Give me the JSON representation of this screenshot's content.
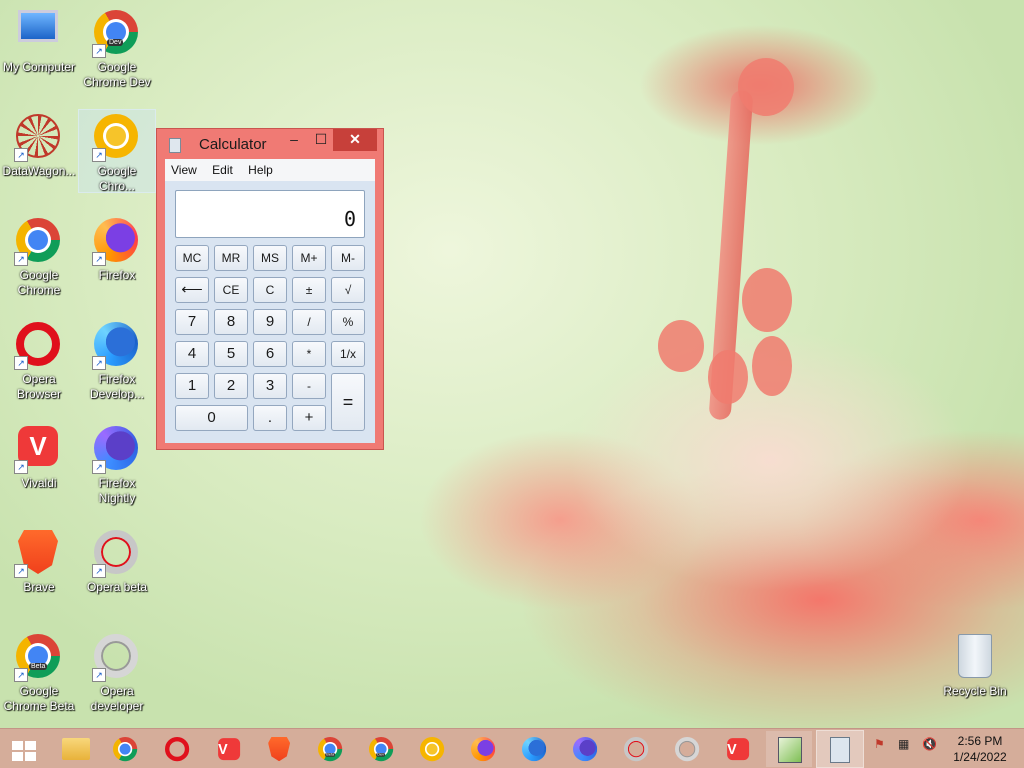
{
  "desktop": {
    "icons": [
      {
        "label": "My Computer"
      },
      {
        "label": "Google Chrome Dev",
        "tag": "Dev"
      },
      {
        "label": "DataWagon..."
      },
      {
        "label": "Google Chro..."
      },
      {
        "label": "Google Chrome"
      },
      {
        "label": "Firefox"
      },
      {
        "label": "Opera Browser"
      },
      {
        "label": "Firefox Develop..."
      },
      {
        "label": "Vivaldi"
      },
      {
        "label": "Firefox Nightly"
      },
      {
        "label": "Brave"
      },
      {
        "label": "Opera beta"
      },
      {
        "label": "Google Chrome Beta",
        "tag": "Beta"
      },
      {
        "label": "Opera developer"
      },
      {
        "label": "Recycle Bin"
      }
    ]
  },
  "calculator": {
    "title": "Calculator",
    "window_buttons": {
      "minimize": "–",
      "maximize": "☐",
      "close": "✕"
    },
    "menu": [
      "View",
      "Edit",
      "Help"
    ],
    "display": "0",
    "keys": {
      "mc": "MC",
      "mr": "MR",
      "ms": "MS",
      "mplus": "M+",
      "mminus": "M-",
      "back": "⟵",
      "ce": "CE",
      "c": "C",
      "sign": "±",
      "sqrt": "√",
      "k7": "7",
      "k8": "8",
      "k9": "9",
      "div": "/",
      "pct": "%",
      "k4": "4",
      "k5": "5",
      "k6": "6",
      "mul": "*",
      "recip": "1/x",
      "k1": "1",
      "k2": "2",
      "k3": "3",
      "sub": "-",
      "eq": "=",
      "k0": "0",
      "dot": ".",
      "add": "+"
    }
  },
  "taskbar": {
    "clock_time": "2:56 PM",
    "clock_date": "1/24/2022",
    "tray_icons": [
      "flag-icon",
      "network-icon",
      "volume-muted-icon"
    ],
    "tags": {
      "beta": "Beta",
      "dev": "Dev"
    }
  },
  "colors": {
    "calc_frame": "#f07a74",
    "close_button": "#c7403a",
    "taskbar": "#d6a898"
  }
}
